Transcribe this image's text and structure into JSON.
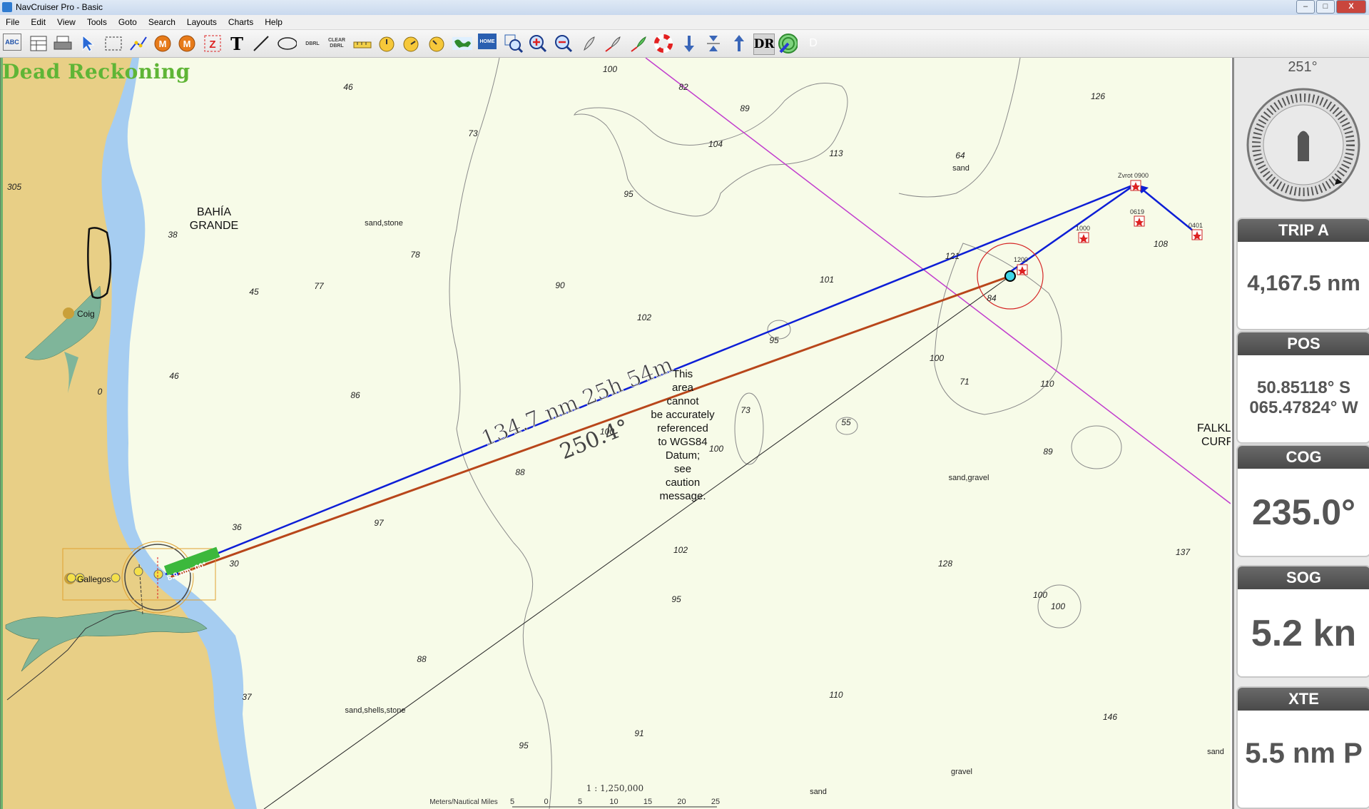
{
  "window": {
    "title": "NavCruiser Pro - Basic",
    "minimize": "–",
    "maximize": "□",
    "close": "X"
  },
  "menu": [
    "File",
    "Edit",
    "View",
    "Tools",
    "Goto",
    "Search",
    "Layouts",
    "Charts",
    "Help"
  ],
  "toolbar": {
    "dr_label": "DR",
    "d_label": "D",
    "dbl_label": "DBRL",
    "clear_dbrl_label": "CLEAR DBRL",
    "abc_label": "ABC",
    "home_label": "HOME"
  },
  "mode": "Dead Reckoning",
  "map": {
    "place_labels": {
      "bahia_line1": "BAHÍA",
      "bahia_line2": "GRANDE",
      "coig": "Coig",
      "gallegos": "Gallegos",
      "falkl": "FALKL",
      "curr": "CURF"
    },
    "route_labels": {
      "distance_time": "134.7 nm  25h 54m",
      "bearing": "250.4°",
      "boat_tag": "8.9 nm, 00°"
    },
    "waypoints": {
      "w0900": "Zvrot 0900",
      "w0619": "0619",
      "w0401": "0401",
      "w1000": "1000",
      "w1200": "1200"
    },
    "datum_warning": [
      "This",
      "area",
      "cannot",
      "be accurately",
      "referenced",
      "to WGS84",
      "Datum;",
      "see",
      "caution",
      "message."
    ],
    "depths": [
      "100",
      "82",
      "89",
      "126",
      "46",
      "73",
      "104",
      "113",
      "64",
      "95",
      "305",
      "38",
      "78",
      "90",
      "101",
      "121",
      "84",
      "108",
      "45",
      "77",
      "102",
      "95",
      "100",
      "71",
      "110",
      "46",
      "86",
      "73",
      "55",
      "100",
      "89",
      "88",
      "100",
      "97",
      "36",
      "30",
      "102",
      "128",
      "137",
      "100",
      "100",
      "95",
      "88",
      "37",
      "110",
      "146",
      "95",
      "91",
      "0"
    ],
    "bottom_types": [
      "sand",
      "sand,stone",
      "sand,gravel",
      "sand,shells,stone",
      "gravel",
      "sand",
      "sand"
    ],
    "scale": {
      "ratio": "1 : 1,250,000",
      "unit_label": "Meters/Nautical Miles",
      "ticks": [
        "5",
        "0",
        "5",
        "10",
        "15",
        "20",
        "25"
      ]
    }
  },
  "side": {
    "compass_heading": "251°",
    "panels": [
      {
        "title": "TRIP A",
        "value": "4,167.5 nm"
      },
      {
        "title": "POS",
        "value_lat": "50.85118° S",
        "value_lon": "065.47824° W"
      },
      {
        "title": "COG",
        "value": "235.0°"
      },
      {
        "title": "SOG",
        "value": "5.2 kn"
      },
      {
        "title": "XTE",
        "value": "5.5 nm P"
      }
    ]
  },
  "colors": {
    "land": "#e8cf86",
    "water_shallow": "#a6cdf1",
    "sea": "#f7fbe8",
    "route": "#0d1ed6",
    "dr_track": "#b8461a",
    "mode_text": "#5fb536",
    "boundary": "#c13ccd"
  }
}
